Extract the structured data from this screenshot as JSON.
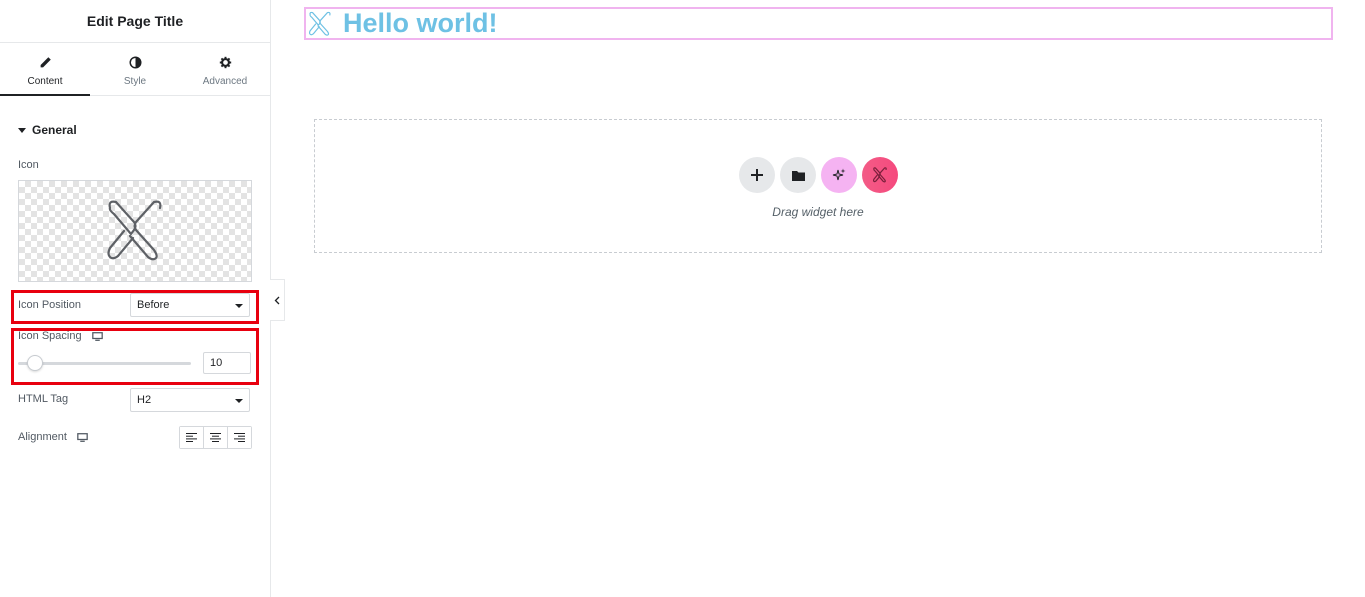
{
  "sidebar": {
    "title": "Edit Page Title",
    "tabs": [
      {
        "label": "Content",
        "icon": "pencil-icon",
        "active": true
      },
      {
        "label": "Style",
        "icon": "half-circle-icon",
        "active": false
      },
      {
        "label": "Advanced",
        "icon": "gear-icon",
        "active": false
      }
    ],
    "section": "General",
    "icon_label": "Icon",
    "icon_position_label": "Icon Position",
    "icon_position_value": "Before",
    "icon_spacing_label": "Icon Spacing",
    "icon_spacing_value": "10",
    "html_tag_label": "HTML Tag",
    "html_tag_value": "H2",
    "alignment_label": "Alignment"
  },
  "canvas": {
    "heading_text": "Hello world!",
    "drop_text": "Drag widget here"
  },
  "colors": {
    "highlight": "#e8000f",
    "heading": "#6ec1e4",
    "selection_outline": "#f0b4ef",
    "ai_button": "#f5b3f2",
    "brand_button": "#f54a7e"
  }
}
